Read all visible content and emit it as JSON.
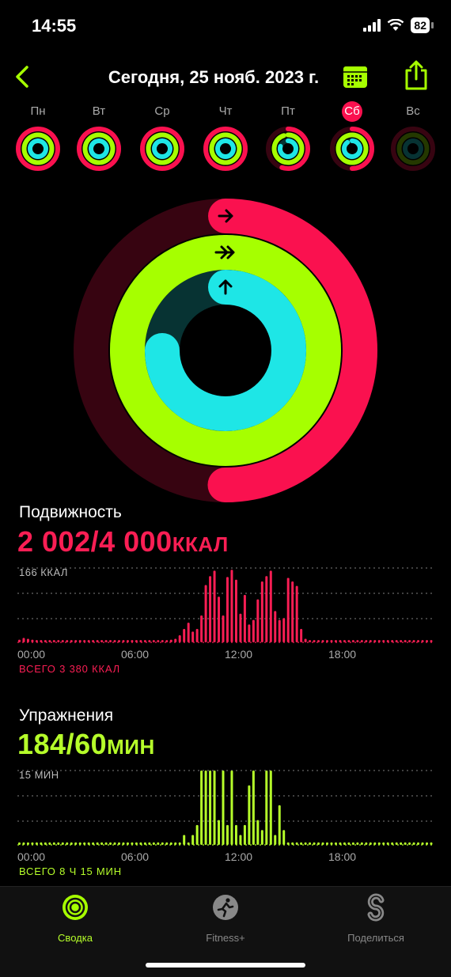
{
  "status_bar": {
    "time": "14:55",
    "battery": "82"
  },
  "nav": {
    "title": "Сегодня, 25 нояб. 2023 г."
  },
  "week": [
    {
      "label": "Пн",
      "move": 1.0,
      "exercise": 1.0,
      "stand": 1.0,
      "active": false
    },
    {
      "label": "Вт",
      "move": 1.0,
      "exercise": 1.0,
      "stand": 1.0,
      "active": false
    },
    {
      "label": "Ср",
      "move": 1.0,
      "exercise": 1.0,
      "stand": 1.0,
      "active": false
    },
    {
      "label": "Чт",
      "move": 1.0,
      "exercise": 1.0,
      "stand": 1.0,
      "active": false
    },
    {
      "label": "Пт",
      "move": 0.55,
      "exercise": 0.95,
      "stand": 0.8,
      "active": false
    },
    {
      "label": "Сб",
      "move": 0.5,
      "exercise": 1.0,
      "stand": 0.9,
      "active": true
    },
    {
      "label": "Вс",
      "move": 0.0,
      "exercise": 0.0,
      "stand": 0.0,
      "active": false
    }
  ],
  "rings": {
    "move": 0.5005,
    "exercise": 1.0,
    "stand": 0.75
  },
  "colors": {
    "move": "#fa114f",
    "exercise": "#a6ff00",
    "stand": "#1ee6e6"
  },
  "move": {
    "title": "Подвижность",
    "value": "2 002/4 000",
    "unit": "ККАЛ",
    "max_label": "166 ККАЛ",
    "total": "ВСЕГО 3 380 ККАЛ"
  },
  "exercise": {
    "title": "Упражнения",
    "value": "184/60",
    "unit": "МИН",
    "max_label": "15 МИН",
    "total": "ВСЕГО 8 Ч 15 МИН"
  },
  "x_ticks": [
    "00:00",
    "06:00",
    "12:00",
    "18:00"
  ],
  "chart_data": [
    {
      "type": "bar",
      "title": "Подвижность",
      "ylabel": "ККАЛ",
      "ylim": [
        0,
        166
      ],
      "x": [
        "00:00",
        "00:15",
        "00:30",
        "00:45",
        "01:00",
        "01:15",
        "01:30",
        "01:45",
        "02:00",
        "02:15",
        "02:30",
        "02:45",
        "03:00",
        "03:15",
        "03:30",
        "03:45",
        "04:00",
        "04:15",
        "04:30",
        "04:45",
        "05:00",
        "05:15",
        "05:30",
        "05:45",
        "06:00",
        "06:15",
        "06:30",
        "06:45",
        "07:00",
        "07:15",
        "07:30",
        "07:45",
        "08:00",
        "08:15",
        "08:30",
        "08:45",
        "09:00",
        "09:15",
        "09:30",
        "09:45",
        "10:00",
        "10:15",
        "10:30",
        "10:45",
        "11:00",
        "11:15",
        "11:30",
        "11:45",
        "12:00",
        "12:15",
        "12:30",
        "12:45",
        "13:00",
        "13:15",
        "13:30",
        "13:45",
        "14:00",
        "14:15",
        "14:30",
        "14:45",
        "15:00",
        "15:15",
        "15:30",
        "15:45",
        "16:00",
        "16:15",
        "16:30",
        "16:45",
        "17:00",
        "17:15",
        "17:30",
        "17:45",
        "18:00",
        "18:15",
        "18:30",
        "18:45",
        "19:00",
        "19:15",
        "19:30",
        "19:45",
        "20:00",
        "20:15",
        "20:30",
        "20:45",
        "21:00",
        "21:15",
        "21:30",
        "21:45",
        "22:00",
        "22:15",
        "22:30",
        "22:45",
        "23:00",
        "23:15",
        "23:30",
        "23:45"
      ],
      "values": [
        6,
        10,
        8,
        6,
        5,
        5,
        5,
        5,
        5,
        5,
        5,
        5,
        5,
        5,
        5,
        5,
        5,
        5,
        5,
        5,
        5,
        5,
        5,
        5,
        5,
        5,
        5,
        5,
        5,
        5,
        5,
        5,
        5,
        5,
        5,
        6,
        8,
        16,
        30,
        44,
        24,
        30,
        60,
        128,
        148,
        160,
        102,
        60,
        146,
        162,
        140,
        64,
        106,
        40,
        50,
        96,
        136,
        148,
        160,
        70,
        50,
        54,
        144,
        136,
        126,
        30,
        8,
        5,
        5,
        5,
        5,
        5,
        5,
        5,
        5,
        5,
        5,
        5,
        5,
        5,
        5,
        5,
        5,
        5,
        5,
        5,
        5,
        5,
        5,
        5,
        5,
        5,
        5,
        5,
        5,
        5
      ]
    },
    {
      "type": "bar",
      "title": "Упражнения",
      "ylabel": "МИН",
      "ylim": [
        0,
        15
      ],
      "x": [
        "00:00",
        "00:15",
        "00:30",
        "00:45",
        "01:00",
        "01:15",
        "01:30",
        "01:45",
        "02:00",
        "02:15",
        "02:30",
        "02:45",
        "03:00",
        "03:15",
        "03:30",
        "03:45",
        "04:00",
        "04:15",
        "04:30",
        "04:45",
        "05:00",
        "05:15",
        "05:30",
        "05:45",
        "06:00",
        "06:15",
        "06:30",
        "06:45",
        "07:00",
        "07:15",
        "07:30",
        "07:45",
        "08:00",
        "08:15",
        "08:30",
        "08:45",
        "09:00",
        "09:15",
        "09:30",
        "09:45",
        "10:00",
        "10:15",
        "10:30",
        "10:45",
        "11:00",
        "11:15",
        "11:30",
        "11:45",
        "12:00",
        "12:15",
        "12:30",
        "12:45",
        "13:00",
        "13:15",
        "13:30",
        "13:45",
        "14:00",
        "14:15",
        "14:30",
        "14:45",
        "15:00",
        "15:15",
        "15:30",
        "15:45",
        "16:00",
        "16:15",
        "16:30",
        "16:45",
        "17:00",
        "17:15",
        "17:30",
        "17:45",
        "18:00",
        "18:15",
        "18:30",
        "18:45",
        "19:00",
        "19:15",
        "19:30",
        "19:45",
        "20:00",
        "20:15",
        "20:30",
        "20:45",
        "21:00",
        "21:15",
        "21:30",
        "21:45",
        "22:00",
        "22:15",
        "22:30",
        "22:45",
        "23:00",
        "23:15",
        "23:30",
        "23:45"
      ],
      "values": [
        0.5,
        0.5,
        0.5,
        0.5,
        0.5,
        0.5,
        0.5,
        0.5,
        0.5,
        0.5,
        0.5,
        0.5,
        0.5,
        0.5,
        0.5,
        0.5,
        0.5,
        0.5,
        0.5,
        0.5,
        0.5,
        0.5,
        0.5,
        0.5,
        0.5,
        0.5,
        0.5,
        0.5,
        0.5,
        0.5,
        0.5,
        0.5,
        0.5,
        0.5,
        0.5,
        0.5,
        0.5,
        0.5,
        2,
        0.5,
        2,
        4,
        15,
        15,
        15,
        15,
        5,
        15,
        4,
        15,
        4,
        2,
        4,
        12,
        15,
        5,
        3,
        15,
        15,
        2,
        8,
        3,
        0.5,
        0.5,
        0.5,
        0.5,
        0.5,
        0.5,
        0.5,
        0.5,
        0.5,
        0.5,
        0.5,
        0.5,
        0.5,
        0.5,
        0.5,
        0.5,
        0.5,
        0.5,
        0.5,
        0.5,
        0.5,
        0.5,
        0.5,
        0.5,
        0.5,
        0.5,
        0.5,
        0.5,
        0.5,
        0.5,
        0.5,
        0.5,
        0.5,
        0.5
      ]
    }
  ],
  "tabs": [
    {
      "label": "Сводка",
      "icon": "summary-rings-icon",
      "active": true
    },
    {
      "label": "Fitness+",
      "icon": "fitness-plus-icon",
      "active": false
    },
    {
      "label": "Поделиться",
      "icon": "sharing-icon",
      "active": false
    }
  ]
}
